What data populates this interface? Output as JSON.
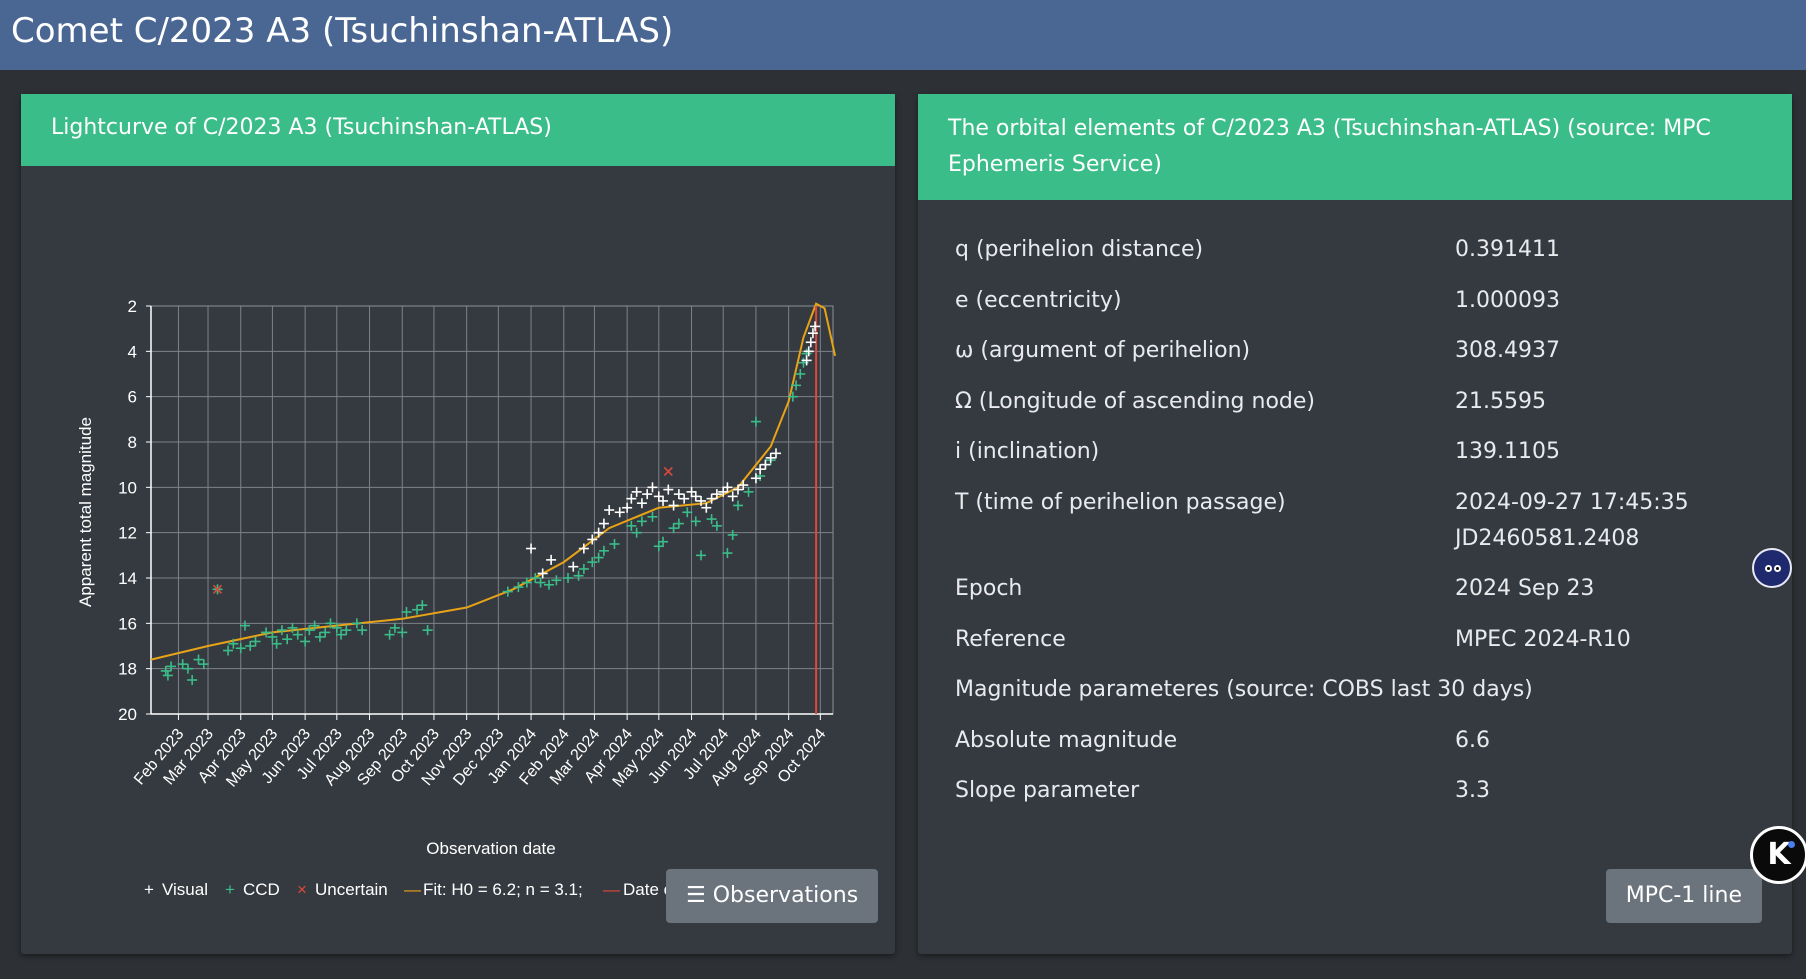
{
  "page_title": "Comet C/2023 A3 (Tsuchinshan-ATLAS)",
  "lightcurve": {
    "header": "Lightcurve of C/2023 A3 (Tsuchinshan-ATLAS)",
    "observations_button": "Observations"
  },
  "orbital": {
    "header": "The orbital elements of C/2023 A3 (Tsuchinshan-ATLAS) (source: MPC Ephemeris Service)",
    "rows": [
      {
        "label": "q (perihelion distance)",
        "value": "0.391411"
      },
      {
        "label": "e (eccentricity)",
        "value": "1.000093"
      },
      {
        "label": "ω (argument of perihelion)",
        "value": "308.4937"
      },
      {
        "label": "Ω (Longitude of ascending node)",
        "value": "21.5595"
      },
      {
        "label": "i (inclination)",
        "value": "139.1105"
      },
      {
        "label": "T (time of perihelion passage)",
        "value": "2024-09-27 17:45:35",
        "value2": "JD2460581.2408"
      },
      {
        "label": "Epoch",
        "value": "2024 Sep 23"
      },
      {
        "label": "Reference",
        "value": "MPEC 2024-R10"
      }
    ],
    "magnitude_heading": "Magnitude parameteres (source: COBS last 30 days)",
    "mag_rows": [
      {
        "label": "Absolute magnitude",
        "value": "6.6"
      },
      {
        "label": "Slope parameter",
        "value": "3.3"
      }
    ],
    "mpc_button": "MPC-1 line"
  },
  "colors": {
    "header_bar": "#4a6794",
    "card_header": "#3bbd8a",
    "visual": "#ffffff",
    "ccd": "#3bbd8a",
    "uncertain": "#e0483a",
    "fit": "#e8a317",
    "perihelion": "#e0483a"
  },
  "chart_data": {
    "type": "scatter",
    "xlabel": "Observation date",
    "ylabel": "Apparent total magnitude",
    "ylim": [
      20,
      2
    ],
    "yticks": [
      2,
      4,
      6,
      8,
      10,
      12,
      14,
      16,
      18,
      20
    ],
    "x_ticks": [
      "Feb 2023",
      "Mar 2023",
      "Apr 2023",
      "May 2023",
      "Jun 2023",
      "Jul 2023",
      "Aug 2023",
      "Sep 2023",
      "Oct 2023",
      "Nov 2023",
      "Dec 2023",
      "Jan 2024",
      "Feb 2024",
      "Mar 2024",
      "Apr 2024",
      "May 2024",
      "Jun 2024",
      "Jul 2024",
      "Aug 2024",
      "Sep 2024",
      "Oct 2024"
    ],
    "grid": true,
    "legend_position": "bottom",
    "legend": [
      "Visual",
      "CCD",
      "Uncertain",
      "Fit: H0 = 6.2; n = 3.1;",
      "Date of Perihelion"
    ],
    "perihelion_date": "2024-09-27",
    "fit_curve": [
      [
        "2023-01-06",
        17.6
      ],
      [
        "2023-03-01",
        17.0
      ],
      [
        "2023-05-01",
        16.4
      ],
      [
        "2023-07-01",
        16.1
      ],
      [
        "2023-09-01",
        15.8
      ],
      [
        "2023-11-01",
        15.3
      ],
      [
        "2023-12-15",
        14.5
      ],
      [
        "2024-02-01",
        13.3
      ],
      [
        "2024-03-15",
        11.8
      ],
      [
        "2024-05-01",
        10.9
      ],
      [
        "2024-06-15",
        10.7
      ],
      [
        "2024-07-15",
        10.0
      ],
      [
        "2024-08-15",
        8.2
      ],
      [
        "2024-09-01",
        6.2
      ],
      [
        "2024-09-15",
        3.4
      ],
      [
        "2024-09-27",
        1.9
      ],
      [
        "2024-10-05",
        2.1
      ],
      [
        "2024-10-15",
        4.2
      ]
    ],
    "series": [
      {
        "name": "CCD",
        "points": [
          [
            "2023-01-20",
            18.1
          ],
          [
            "2023-01-22",
            18.3
          ],
          [
            "2023-01-25",
            17.9
          ],
          [
            "2023-02-05",
            17.8
          ],
          [
            "2023-02-10",
            18.0
          ],
          [
            "2023-02-14",
            18.5
          ],
          [
            "2023-02-20",
            17.6
          ],
          [
            "2023-02-25",
            17.8
          ],
          [
            "2023-03-10",
            14.5
          ],
          [
            "2023-03-20",
            17.2
          ],
          [
            "2023-03-25",
            16.9
          ],
          [
            "2023-04-01",
            17.1
          ],
          [
            "2023-04-05",
            16.1
          ],
          [
            "2023-04-10",
            17.0
          ],
          [
            "2023-04-15",
            16.8
          ],
          [
            "2023-04-25",
            16.4
          ],
          [
            "2023-05-01",
            16.6
          ],
          [
            "2023-05-05",
            16.9
          ],
          [
            "2023-05-10",
            16.3
          ],
          [
            "2023-05-15",
            16.7
          ],
          [
            "2023-05-20",
            16.2
          ],
          [
            "2023-05-25",
            16.5
          ],
          [
            "2023-06-01",
            16.8
          ],
          [
            "2023-06-05",
            16.3
          ],
          [
            "2023-06-10",
            16.1
          ],
          [
            "2023-06-15",
            16.6
          ],
          [
            "2023-06-20",
            16.4
          ],
          [
            "2023-06-25",
            16.0
          ],
          [
            "2023-07-01",
            16.2
          ],
          [
            "2023-07-05",
            16.5
          ],
          [
            "2023-07-10",
            16.3
          ],
          [
            "2023-07-20",
            16.0
          ],
          [
            "2023-07-25",
            16.3
          ],
          [
            "2023-08-20",
            16.5
          ],
          [
            "2023-08-25",
            16.2
          ],
          [
            "2023-09-01",
            16.4
          ],
          [
            "2023-09-05",
            15.5
          ],
          [
            "2023-09-15",
            15.4
          ],
          [
            "2023-09-20",
            15.2
          ],
          [
            "2023-09-25",
            16.3
          ],
          [
            "2023-12-10",
            14.6
          ],
          [
            "2023-12-20",
            14.4
          ],
          [
            "2023-12-28",
            14.2
          ],
          [
            "2024-01-05",
            14.0
          ],
          [
            "2024-01-10",
            14.2
          ],
          [
            "2024-01-18",
            14.3
          ],
          [
            "2024-01-25",
            14.1
          ],
          [
            "2024-02-05",
            14.0
          ],
          [
            "2024-02-15",
            13.9
          ],
          [
            "2024-02-20",
            13.6
          ],
          [
            "2024-02-28",
            13.3
          ],
          [
            "2024-03-05",
            13.1
          ],
          [
            "2024-03-10",
            12.8
          ],
          [
            "2024-03-20",
            12.5
          ],
          [
            "2024-04-05",
            11.7
          ],
          [
            "2024-04-10",
            12.0
          ],
          [
            "2024-04-15",
            11.5
          ],
          [
            "2024-04-25",
            11.3
          ],
          [
            "2024-05-01",
            12.6
          ],
          [
            "2024-05-05",
            12.4
          ],
          [
            "2024-05-15",
            11.8
          ],
          [
            "2024-05-20",
            11.6
          ],
          [
            "2024-05-28",
            11.1
          ],
          [
            "2024-06-05",
            11.5
          ],
          [
            "2024-06-10",
            13.0
          ],
          [
            "2024-06-20",
            11.4
          ],
          [
            "2024-06-25",
            11.7
          ],
          [
            "2024-07-05",
            12.9
          ],
          [
            "2024-07-10",
            12.1
          ],
          [
            "2024-07-15",
            10.8
          ],
          [
            "2024-07-25",
            10.2
          ],
          [
            "2024-08-01",
            7.1
          ],
          [
            "2024-08-05",
            9.5
          ],
          [
            "2024-08-10",
            9.0
          ],
          [
            "2024-08-15",
            8.8
          ],
          [
            "2024-09-05",
            6.0
          ],
          [
            "2024-09-08",
            5.5
          ],
          [
            "2024-09-12",
            5.0
          ],
          [
            "2024-09-15",
            4.5
          ],
          [
            "2024-09-18",
            4.1
          ]
        ]
      },
      {
        "name": "Visual",
        "points": [
          [
            "2024-01-01",
            12.7
          ],
          [
            "2024-01-12",
            13.8
          ],
          [
            "2024-01-20",
            13.2
          ],
          [
            "2024-02-10",
            13.5
          ],
          [
            "2024-02-20",
            12.7
          ],
          [
            "2024-02-28",
            12.3
          ],
          [
            "2024-03-05",
            12.0
          ],
          [
            "2024-03-10",
            11.6
          ],
          [
            "2024-03-15",
            11.0
          ],
          [
            "2024-03-25",
            11.1
          ],
          [
            "2024-04-01",
            10.9
          ],
          [
            "2024-04-05",
            10.5
          ],
          [
            "2024-04-10",
            10.2
          ],
          [
            "2024-04-15",
            10.7
          ],
          [
            "2024-04-20",
            10.3
          ],
          [
            "2024-04-25",
            10.0
          ],
          [
            "2024-05-01",
            10.4
          ],
          [
            "2024-05-05",
            10.6
          ],
          [
            "2024-05-10",
            10.1
          ],
          [
            "2024-05-15",
            10.8
          ],
          [
            "2024-05-20",
            10.3
          ],
          [
            "2024-05-25",
            10.5
          ],
          [
            "2024-06-01",
            10.2
          ],
          [
            "2024-06-05",
            10.4
          ],
          [
            "2024-06-10",
            10.6
          ],
          [
            "2024-06-15",
            10.9
          ],
          [
            "2024-06-20",
            10.5
          ],
          [
            "2024-06-25",
            10.3
          ],
          [
            "2024-07-01",
            10.2
          ],
          [
            "2024-07-05",
            10.0
          ],
          [
            "2024-07-10",
            10.4
          ],
          [
            "2024-07-15",
            10.1
          ],
          [
            "2024-07-20",
            9.9
          ],
          [
            "2024-08-01",
            9.6
          ],
          [
            "2024-08-05",
            9.2
          ],
          [
            "2024-08-10",
            9.0
          ],
          [
            "2024-08-15",
            8.7
          ],
          [
            "2024-08-20",
            8.5
          ],
          [
            "2024-09-18",
            4.4
          ],
          [
            "2024-09-20",
            4.0
          ],
          [
            "2024-09-22",
            3.6
          ],
          [
            "2024-09-24",
            3.2
          ],
          [
            "2024-09-26",
            2.9
          ]
        ]
      },
      {
        "name": "Uncertain",
        "points": [
          [
            "2023-03-10",
            14.5
          ],
          [
            "2024-05-10",
            9.3
          ]
        ]
      }
    ]
  },
  "chart_text": {
    "ylabel": "Apparent total magnitude",
    "xlabel": "Observation date",
    "legend_visual": "Visual",
    "legend_ccd": "CCD",
    "legend_uncertain": "Uncertain",
    "legend_fit": "Fit: H0 = 6.2; n = 3.1;",
    "legend_perihelion": "Date of Perihelion"
  }
}
